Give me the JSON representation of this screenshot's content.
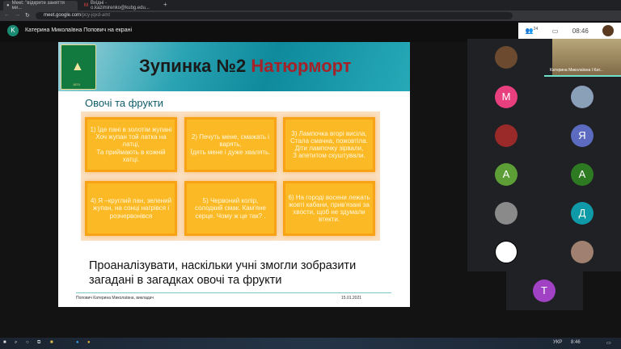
{
  "browser": {
    "tabs": [
      {
        "label": "Meet: \"відкрите заняття ми...",
        "active": true
      },
      {
        "label": "Вхідні - o.kazimirenko@kubg.edu...",
        "active": false
      }
    ],
    "new_tab": "+",
    "url_host": "meet.google.com",
    "url_path": "/pcy-jqxd-amt"
  },
  "meet": {
    "presenter_initial": "K",
    "presenter_text": "Катерина Миколаївна Попович на екрані",
    "participants_count": "24",
    "time": "08:46",
    "self_name": "Катерина Миколаївна І Кат...",
    "participants": [
      {
        "initial": "",
        "color": "#6b4a2f"
      },
      {
        "initial": "M",
        "color": "#e8407e"
      },
      {
        "initial": "",
        "color": "#8aa0b8"
      },
      {
        "initial": "",
        "color": "#9a2a2a"
      },
      {
        "initial": "Я",
        "color": "#5c6bc0"
      },
      {
        "initial": "A",
        "color": "#5d9f36"
      },
      {
        "initial": "A",
        "color": "#2e7a22"
      },
      {
        "initial": "",
        "color": "#8a8a8a"
      },
      {
        "initial": "Д",
        "color": "#0e9aa7"
      },
      {
        "initial": "",
        "color": "#ffffff"
      },
      {
        "initial": "",
        "color": "#a08070"
      }
    ],
    "last_participant": {
      "initial": "T",
      "color": "#a142c4"
    }
  },
  "slide": {
    "title_part1": "Зупинка №2",
    "title_part2": "Натюрморт",
    "subtitle": "Овочі та фрукти",
    "riddles": [
      "1) Їде пані в золотім жупані\nХоч жупан той латка на латці,\nТа приймають в кожній хатці.",
      "2) Печуть мене, смажать і варять,\nЇдять мене і дуже хвалять.",
      "3) Лампочка вгорі висіла,\nСтала смачна, пожовтіла.\nДіти лампочку зірвали,\nЗ апетитом скуштували.",
      "4) Я –круглий пан, зелений жупан, на сонці нагрівся і розчервонівся",
      "5) Червоний колір, солодкий смак. Кам'яне серце. Чому ж це так? .",
      "6) На городі восени лежать жовті кабани, прив'язані за хвости, щоб не здумали втекти."
    ],
    "analysis": "Проаналізувати, наскільки учні змогли зобразити загадані в загадках овочі та фрукти",
    "footer_author": "Попович Катерина Миколаївна, викладач",
    "footer_date": "15.01.2021",
    "logo_year": "1874"
  },
  "taskbar": {
    "lang": "УКР",
    "time": "8:46"
  }
}
